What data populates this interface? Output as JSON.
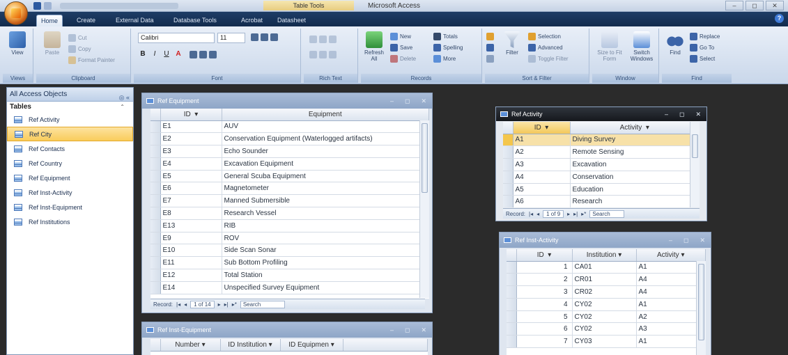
{
  "titlebar": {
    "contextual_tab": "Table Tools",
    "app_title": "Microsoft Access",
    "window_controls": [
      "–",
      "◻",
      "✕"
    ]
  },
  "ribbon_tabs": [
    "Home",
    "Create",
    "External Data",
    "Database Tools",
    "Acrobat",
    "Datasheet"
  ],
  "ribbon": {
    "views": {
      "view_label": "View",
      "group": "Views"
    },
    "clipboard": {
      "paste": "Paste",
      "cut": "Cut",
      "copy": "Copy",
      "format_painter": "Format Painter",
      "group": "Clipboard"
    },
    "font": {
      "font_name": "Calibri",
      "font_size": "11",
      "group": "Font"
    },
    "rich_text": {
      "group": "Rich Text"
    },
    "records": {
      "refresh": "Refresh All",
      "new": "New",
      "save": "Save",
      "delete": "Delete",
      "totals": "Totals",
      "spelling": "Spelling",
      "more": "More",
      "group": "Records"
    },
    "sort_filter": {
      "filter": "Filter",
      "selection": "Selection",
      "advanced": "Advanced",
      "toggle_filter": "Toggle Filter",
      "group": "Sort & Filter"
    },
    "window": {
      "size_to_fit": "Size to Fit Form",
      "switch_windows": "Switch Windows",
      "group": "Window"
    },
    "find": {
      "find": "Find",
      "replace": "Replace",
      "goto": "Go To",
      "select": "Select",
      "group": "Find"
    }
  },
  "nav": {
    "header": "All Access Objects",
    "group": "Tables",
    "items": [
      "Ref Activity",
      "Ref City",
      "Ref Contacts",
      "Ref Country",
      "Ref Equipment",
      "Ref Inst-Activity",
      "Ref Inst-Equipment",
      "Ref Institutions"
    ]
  },
  "equipment": {
    "title": "Ref Equipment",
    "columns": [
      "ID",
      "Equipment"
    ],
    "rows": [
      [
        "E1",
        "AUV"
      ],
      [
        "E2",
        "Conservation Equipment (Waterlogged artifacts)"
      ],
      [
        "E3",
        "Echo Sounder"
      ],
      [
        "E4",
        "Excavation Equipment"
      ],
      [
        "E5",
        "General Scuba Equipment"
      ],
      [
        "E6",
        "Magnetometer"
      ],
      [
        "E7",
        "Manned Submersible"
      ],
      [
        "E8",
        "Research Vessel"
      ],
      [
        "E13",
        "RIB"
      ],
      [
        "E9",
        "ROV"
      ],
      [
        "E10",
        "Side Scan Sonar"
      ],
      [
        "E11",
        "Sub Bottom Profiling"
      ],
      [
        "E12",
        "Total Station"
      ],
      [
        "E14",
        "Unspecified Survey Equipment"
      ]
    ],
    "record_label": "Record:",
    "record_pos": "1 of 14",
    "search": "Search"
  },
  "activity": {
    "title": "Ref Activity",
    "columns": [
      "ID",
      "Activity"
    ],
    "rows": [
      [
        "A1",
        "Diving Survey"
      ],
      [
        "A2",
        "Remote Sensing"
      ],
      [
        "A3",
        "Excavation"
      ],
      [
        "A4",
        "Conservation"
      ],
      [
        "A5",
        "Education"
      ],
      [
        "A6",
        "Research"
      ]
    ],
    "record_label": "Record:",
    "record_pos": "1 of 9",
    "search": "Search"
  },
  "inst_activity": {
    "title": "Ref Inst-Activity",
    "columns": [
      "ID",
      "Institution",
      "Activity"
    ],
    "rows": [
      [
        "1",
        "CA01",
        "A1"
      ],
      [
        "2",
        "CR01",
        "A4"
      ],
      [
        "3",
        "CR02",
        "A4"
      ],
      [
        "4",
        "CY02",
        "A1"
      ],
      [
        "5",
        "CY02",
        "A2"
      ],
      [
        "6",
        "CY02",
        "A3"
      ],
      [
        "7",
        "CY03",
        "A1"
      ]
    ]
  },
  "inst_equipment": {
    "title": "Ref Inst-Equipment",
    "columns": [
      "Number",
      "ID Institution",
      "ID Equipmen"
    ]
  }
}
